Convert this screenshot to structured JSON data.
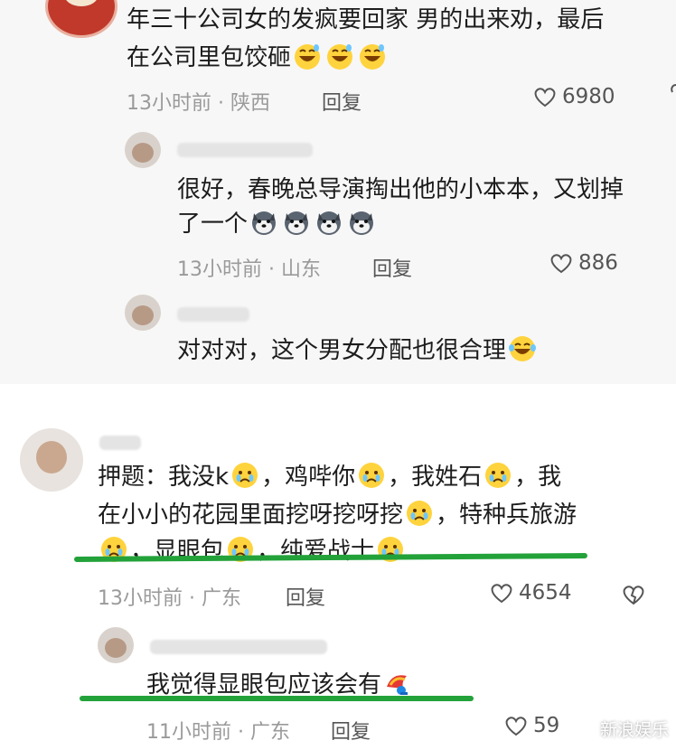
{
  "comments": [
    {
      "text_line1": "年三十公司女的发疯要回家 男的出来劝，最后",
      "text_line2": "在公司里包饺砸",
      "meta": "13小时前 · 陕西",
      "reply_label": "回复",
      "likes": "6980",
      "emoji": "laughing-sweat-emoji",
      "replies": [
        {
          "text_line1": "很好，春晚总导演掏出他的小本本，又划掉",
          "text_line2": "了一个",
          "meta": "13小时前 · 山东",
          "reply_label": "回复",
          "likes": "886",
          "emoji": "husky-dog-emoji"
        },
        {
          "text_line1": "对对对，这个男女分配也很合理",
          "emoji": "laughing-crying-emoji"
        }
      ]
    },
    {
      "text_line1_a": "押题：我没k",
      "text_line1_b": "，鸡哔你",
      "text_line1_c": "，我姓石",
      "text_line1_d": "，我",
      "text_line2_a": "在小小的花园里面挖呀挖呀挖",
      "text_line2_b": "，特种兵旅游",
      "text_line3_a": "，显眼包",
      "text_line3_b": "，纯爱战士",
      "meta": "13小时前 · 广东",
      "reply_label": "回复",
      "likes": "4654",
      "emoji": "crying-face-emoji",
      "reply": {
        "text": "我觉得显眼包应该会有",
        "meta": "11小时前 · 广东",
        "reply_label": "回复",
        "likes": "59",
        "emoji": "peacock-emoji"
      }
    }
  ],
  "watermark": "新浪娱乐",
  "colors": {
    "underline": "#23a23a",
    "meta": "#9a9a9a"
  }
}
